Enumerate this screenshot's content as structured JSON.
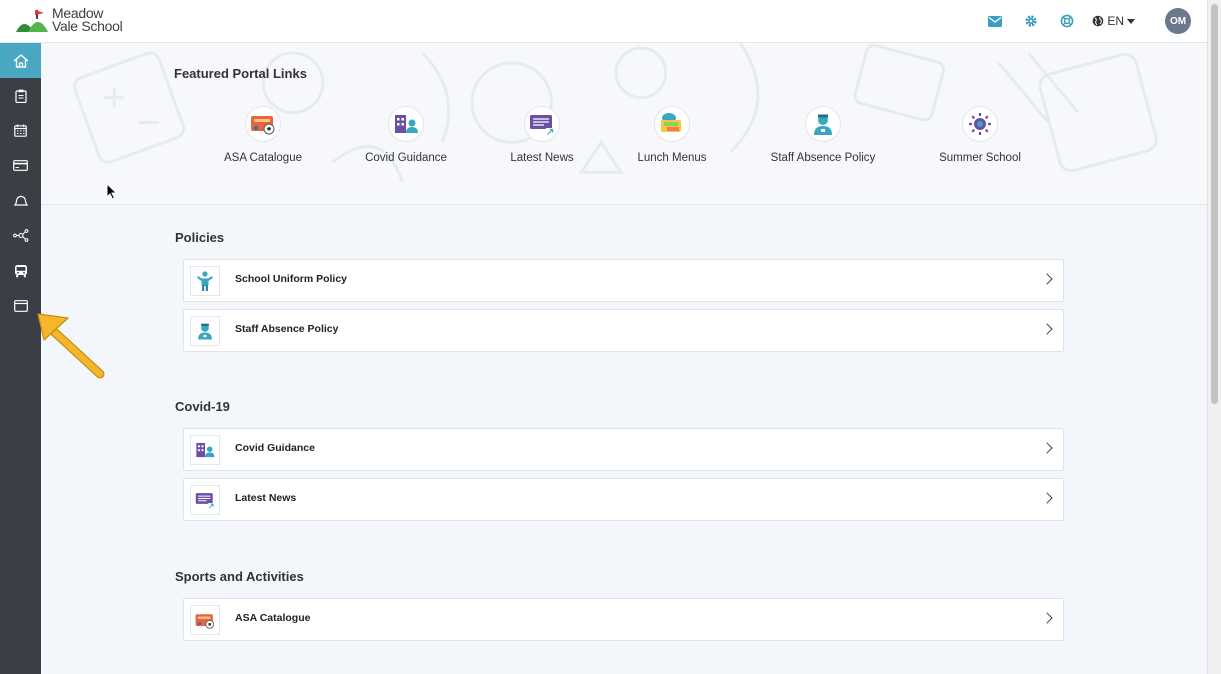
{
  "app": {
    "logo_line1": "Meadow",
    "logo_line2": "Vale School"
  },
  "header": {
    "language": "EN",
    "avatar_initials": "OM"
  },
  "sidebar": {
    "items": [
      {
        "icon": "home-icon"
      },
      {
        "icon": "clipboard-icon"
      },
      {
        "icon": "calendar-icon"
      },
      {
        "icon": "credit-card-icon"
      },
      {
        "icon": "bell-icon"
      },
      {
        "icon": "network-icon"
      },
      {
        "icon": "bus-icon"
      },
      {
        "icon": "browser-window-icon"
      }
    ]
  },
  "featured": {
    "title": "Featured Portal Links",
    "links": [
      {
        "label": "ASA Catalogue",
        "icon": "asa-catalogue-icon"
      },
      {
        "label": "Covid Guidance",
        "icon": "covid-guidance-icon"
      },
      {
        "label": "Latest News",
        "icon": "latest-news-icon"
      },
      {
        "label": "Lunch Menus",
        "icon": "lunch-menus-icon"
      },
      {
        "label": "Staff Absence Policy",
        "icon": "staff-absence-icon"
      },
      {
        "label": "Summer School",
        "icon": "summer-school-icon"
      }
    ]
  },
  "sections": [
    {
      "title": "Policies",
      "items": [
        {
          "label": "School Uniform Policy",
          "icon": "uniform-icon"
        },
        {
          "label": "Staff Absence Policy",
          "icon": "staff-absence-icon"
        }
      ]
    },
    {
      "title": "Covid-19",
      "items": [
        {
          "label": "Covid Guidance",
          "icon": "covid-guidance-icon"
        },
        {
          "label": "Latest News",
          "icon": "latest-news-icon"
        }
      ]
    },
    {
      "title": "Sports and Activities",
      "items": [
        {
          "label": "ASA Catalogue",
          "icon": "asa-catalogue-icon"
        }
      ]
    }
  ],
  "colors": {
    "sidebar_bg": "#3b3e44",
    "accent": "#4aa7c2",
    "annotation_arrow": "#f5b72a"
  }
}
